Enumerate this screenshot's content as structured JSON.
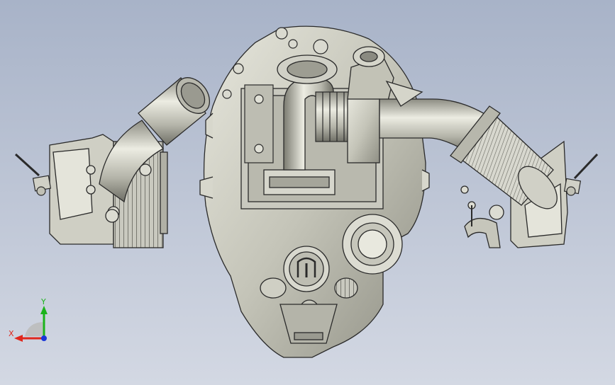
{
  "viewport": {
    "background_top": "#a8b3c8",
    "background_bottom": "#d3d8e3",
    "model_color": "#cfcfc4",
    "edge_color": "#2a2a2a"
  },
  "triad": {
    "x_label": "X",
    "y_label": "Y",
    "x_color": "#e0271c",
    "y_color": "#1bb31b",
    "z_color": "#1a37d8"
  }
}
